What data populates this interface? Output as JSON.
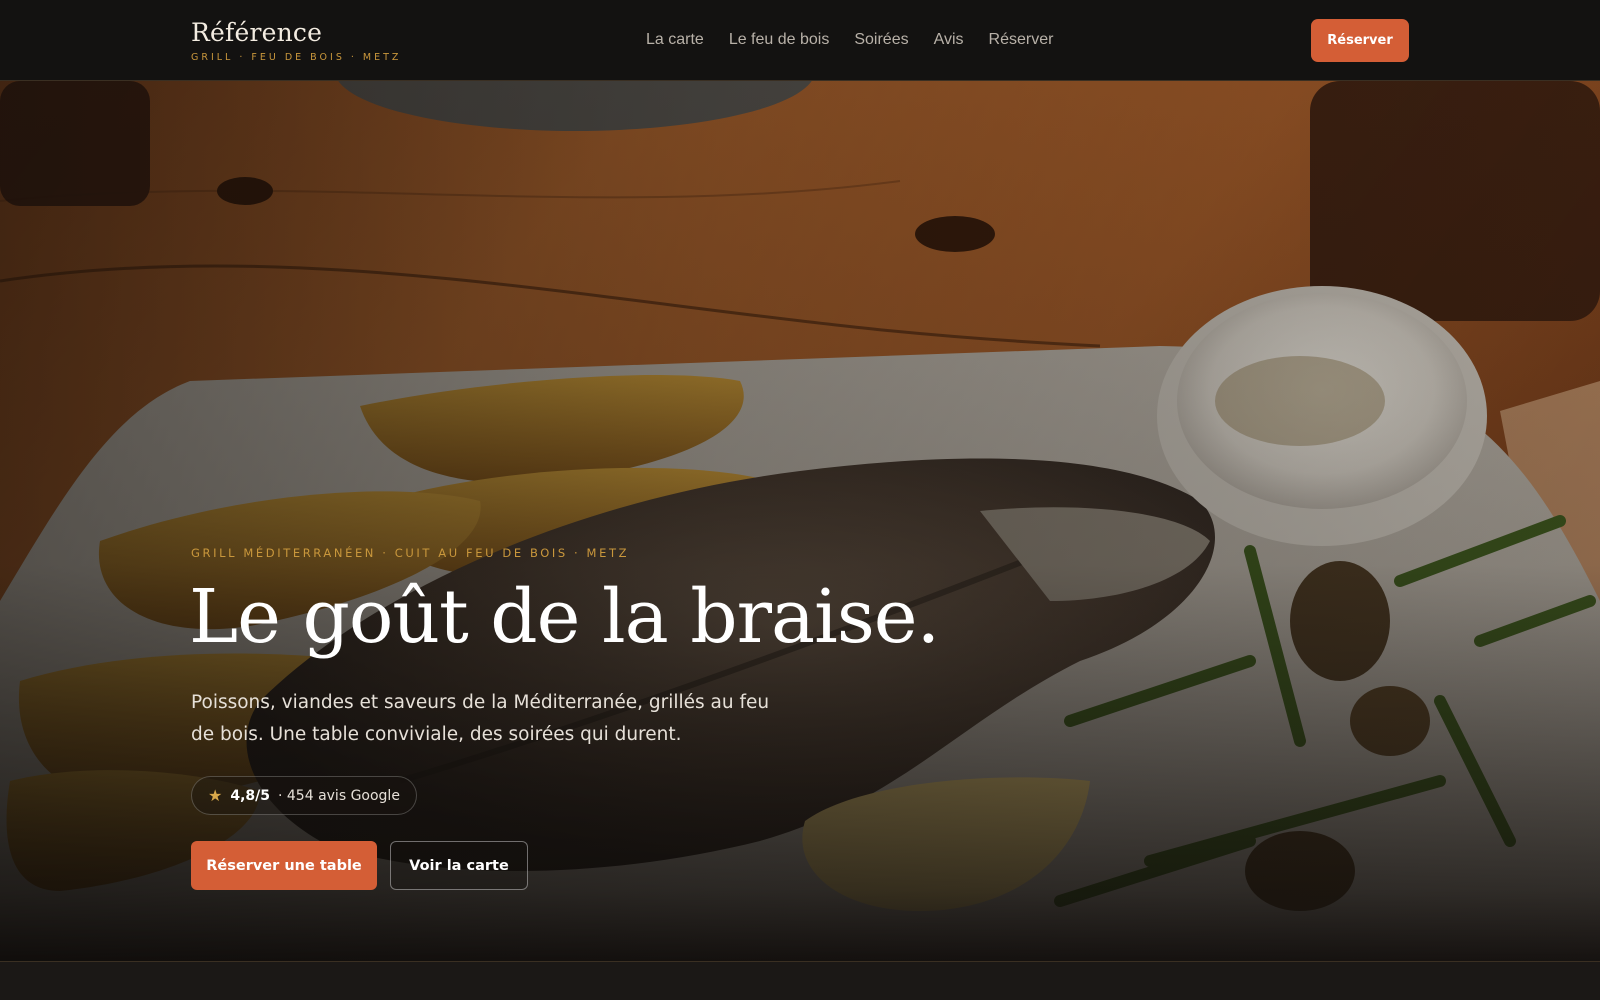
{
  "header": {
    "brand_name": "Référence",
    "brand_tagline": "GRILL · FEU DE BOIS · METZ",
    "nav": [
      {
        "label": "La carte"
      },
      {
        "label": "Le feu de bois"
      },
      {
        "label": "Soirées"
      },
      {
        "label": "Avis"
      },
      {
        "label": "Réserver"
      }
    ],
    "cta_label": "Réserver"
  },
  "hero": {
    "image": "grilled-fish-plate-photo",
    "eyebrow": "GRILL MÉDITERRANÉEN · CUIT AU FEU DE BOIS · METZ",
    "headline": "Le goût de la braise.",
    "subtitle": "Poissons, viandes et saveurs de la Méditerranée, grillés au feu de bois. Une table conviviale, des soirées qui durent.",
    "rating": {
      "icon": "star-icon",
      "score": "4,8/5",
      "count": "· 454 avis Google"
    },
    "primary_button": "Réserver une table",
    "secondary_button": "Voir la carte"
  },
  "colors": {
    "accent": "#d45e36",
    "gold": "#c9973c",
    "header_bg": "#131211",
    "page_bg": "#1b1816"
  }
}
